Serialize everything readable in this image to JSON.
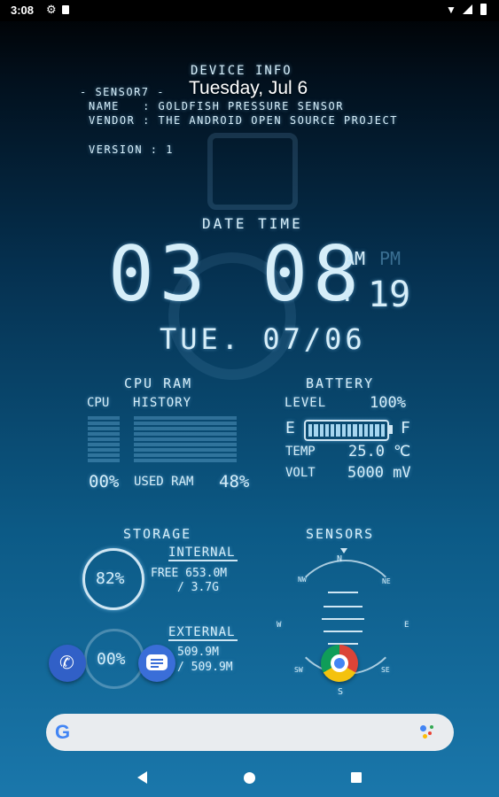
{
  "status_bar": {
    "time": "3:08"
  },
  "date_widget": {
    "text": "Tuesday, Jul 6"
  },
  "device_info": {
    "title": "DEVICE INFO",
    "sensor_label": "- SENSOR7 -",
    "name_row": "NAME   : GOLDFISH PRESSURE SENSOR",
    "vendor_row": "VENDOR : THE ANDROID OPEN SOURCE PROJECT",
    "version_row": "VERSION : 1"
  },
  "date_time": {
    "title": "DATE TIME",
    "clock": "03 08",
    "am": "AM",
    "pm": "PM",
    "colon": ":",
    "seconds": "19",
    "date": "TUE. 07/06"
  },
  "cpu_ram": {
    "title": "CPU RAM",
    "cpu_label": "CPU",
    "history_label": "HISTORY",
    "cpu_percent": "00%",
    "used_ram_label": "USED RAM",
    "ram_percent": "48%"
  },
  "battery": {
    "title": "BATTERY",
    "level_label": "LEVEL",
    "level_value": "100%",
    "level_fraction": 1.0,
    "e_label": "E",
    "f_label": "F",
    "temp_label": "TEMP",
    "temp_value": "25.0 ℃",
    "volt_label": "VOLT",
    "volt_value": "5000 mV"
  },
  "storage": {
    "title": "STORAGE",
    "internal_percent": "82%",
    "internal_label": "INTERNAL",
    "internal_free": "FREE 653.0M",
    "internal_total": "/ 3.7G",
    "external_label": "EXTERNAL",
    "external_percent": "00%",
    "external_free": "509.9M",
    "external_total": "/ 509.9M"
  },
  "sensors": {
    "title": "SENSORS",
    "n": "N",
    "s": "S",
    "w": "W",
    "e": "E",
    "nw": "NW",
    "ne": "NE",
    "sw": "SW",
    "se": "SE"
  },
  "apps": {
    "icons": [
      "phone-icon",
      "messages-icon",
      "chrome-icon"
    ]
  },
  "search": {
    "icons": [
      "google-g-icon",
      "assistant-mic-icon"
    ],
    "g_text": "G"
  },
  "colors": {
    "accent": "#cfe6f3",
    "background_top": "#02101d",
    "background_bottom": "#1a77ab"
  }
}
